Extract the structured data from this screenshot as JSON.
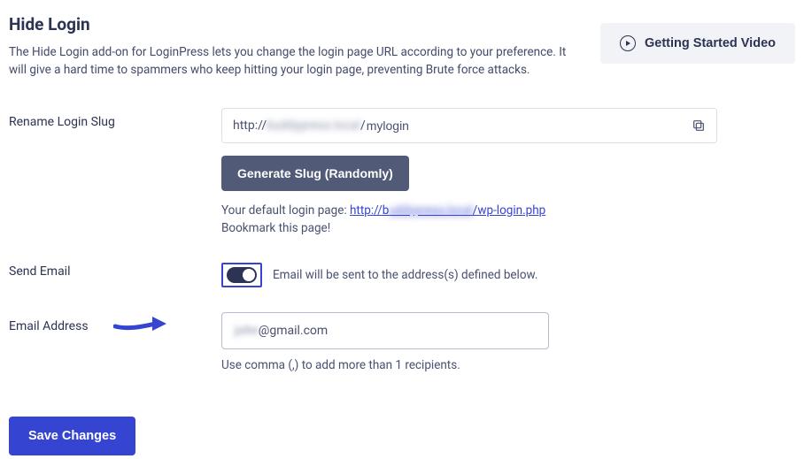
{
  "header": {
    "title": "Hide Login",
    "description": "The Hide Login add-on for LoginPress lets you change the login page URL according to your preference. It will give a hard time to spammers who keep hitting your login page, preventing Brute force attacks.",
    "video_button": "Getting Started Video"
  },
  "slug": {
    "label": "Rename Login Slug",
    "prefix": "http://",
    "domain_masked": "buddypress.local",
    "separator": "/",
    "value": "mylogin",
    "generate_button": "Generate Slug (Randomly)",
    "default_text": "Your default login page: ",
    "default_link_prefix": "http://b",
    "default_link_masked": "uddypress.local",
    "default_link_suffix": "/wp-login.php",
    "bookmark_text": "Bookmark this page!"
  },
  "send_email": {
    "label": "Send Email",
    "enabled": true,
    "description": "Email will be sent to the address(s) defined below."
  },
  "email_address": {
    "label": "Email Address",
    "value_masked": "john",
    "value_suffix": "@gmail.com",
    "hint": "Use comma (,) to add more than 1 recipients."
  },
  "actions": {
    "save": "Save Changes"
  }
}
